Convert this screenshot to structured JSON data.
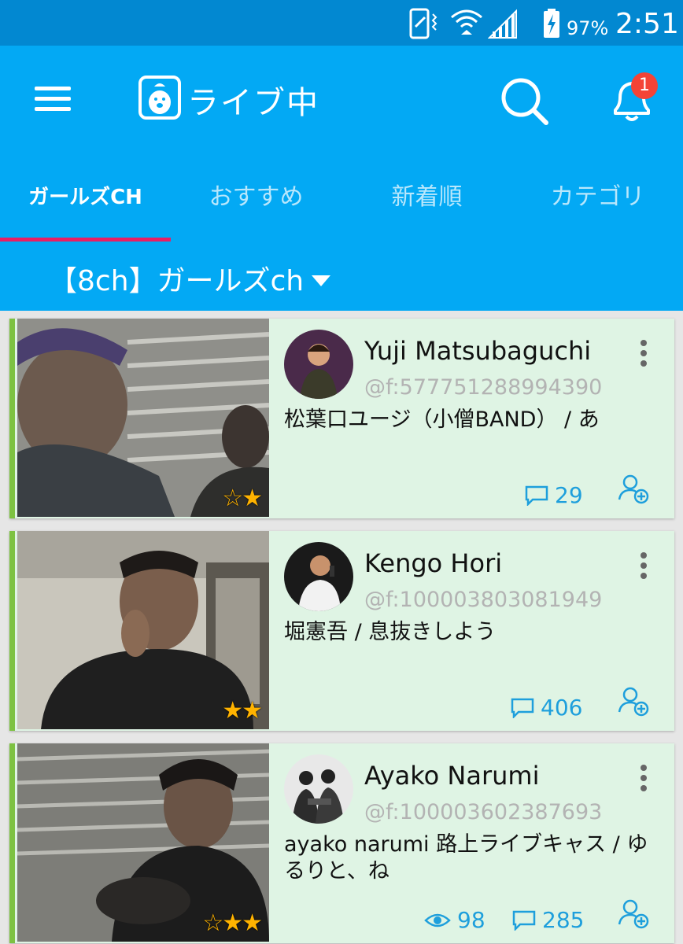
{
  "status_bar": {
    "battery_percent": "97%",
    "time": "2:51"
  },
  "header": {
    "title": "ライブ中",
    "notification_count": "1"
  },
  "tabs": [
    {
      "label": "ガールズCH",
      "active": true
    },
    {
      "label": "おすすめ",
      "active": false
    },
    {
      "label": "新着順",
      "active": false
    },
    {
      "label": "カテゴリ",
      "active": false
    }
  ],
  "channel_selector": {
    "label": "【8ch】ガールズch"
  },
  "broadcasts": [
    {
      "name": "Yuji Matsubaguchi",
      "handle": "@f:577751288994390",
      "description": "松葉口ユージ（小僧BAND） / あ",
      "stars": "☆★",
      "views": null,
      "comments": "29"
    },
    {
      "name": "Kengo Hori",
      "handle": "@f:100003803081949",
      "description": "堀憲吾 / 息抜きしよう",
      "stars": "★★",
      "views": null,
      "comments": "406"
    },
    {
      "name": "Ayako Narumi",
      "handle": "@f:100003602387693",
      "description": "ayako narumi 路上ライブキャス / ゆるりと、ね",
      "stars": "☆★★",
      "views": "98",
      "comments": "285"
    }
  ],
  "colors": {
    "status_bar": "#0288d1",
    "app_bar": "#03a9f4",
    "tab_indicator": "#e91e63",
    "card_bg": "#dff4e4",
    "card_accent": "#7dc242",
    "stat_color": "#1e9fdc",
    "star_color": "#ffb300"
  }
}
